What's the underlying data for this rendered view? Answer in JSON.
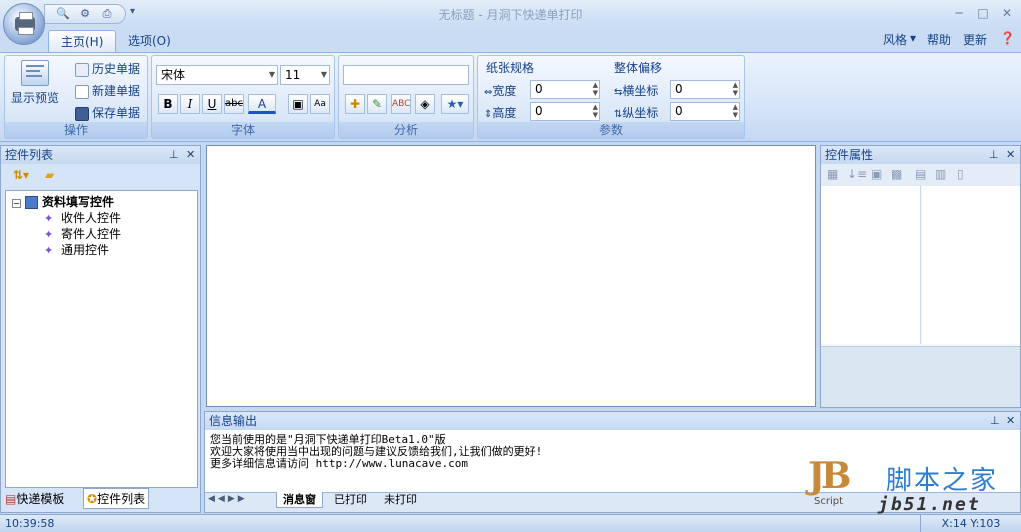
{
  "window": {
    "title": "无标题 - 月洞下快递单打印"
  },
  "qat": {
    "items": [
      "preview-icon",
      "options-icon",
      "print-icon"
    ]
  },
  "tabs": {
    "home": "主页(H)",
    "options": "选项(O)"
  },
  "right_menu": {
    "style": "风格",
    "help": "帮助",
    "update": "更新"
  },
  "ribbon": {
    "ops": {
      "label": "操作",
      "preview": "显示预览",
      "history": "历史单据",
      "new": "新建单据",
      "save": "保存单据"
    },
    "font": {
      "label": "字体",
      "family": "宋体",
      "size": "11",
      "bold": "B",
      "italic": "I",
      "underline": "U",
      "strike": "abc",
      "color": "A"
    },
    "analysis": {
      "label": "分析",
      "input": ""
    },
    "params": {
      "label": "参数",
      "paper": "纸张规格",
      "width_label": "宽度",
      "width": "0",
      "height_label": "高度",
      "height": "0",
      "offset": "整体偏移",
      "x_label": "横坐标",
      "x": "0",
      "y_label": "纵坐标",
      "y": "0"
    }
  },
  "left_panel": {
    "title": "控件列表",
    "root": "资料填写控件",
    "items": [
      "收件人控件",
      "寄件人控件",
      "通用控件"
    ],
    "bottom_tabs": [
      "快递模板",
      "控件列表"
    ]
  },
  "right_panel": {
    "title": "控件属性"
  },
  "output": {
    "title": "信息输出",
    "lines": [
      "您当前使用的是\"月洞下快递单打印Beta1.0\"版",
      "欢迎大家将使用当中出现的问题与建议反馈给我们,让我们做的更好!",
      "更多详细信息请访问 http://www.lunacave.com"
    ],
    "tabs": [
      "消息窗",
      "已打印",
      "未打印"
    ]
  },
  "status": {
    "time": "10:39:58",
    "coords": "X:14 Y:103"
  },
  "watermark": {
    "brand": "脚本之家",
    "url": "jb51.net",
    "logo": "JB",
    "script": "Script"
  },
  "colors": {
    "accent": "#15428b",
    "ribbon": "#d2e2f6"
  }
}
